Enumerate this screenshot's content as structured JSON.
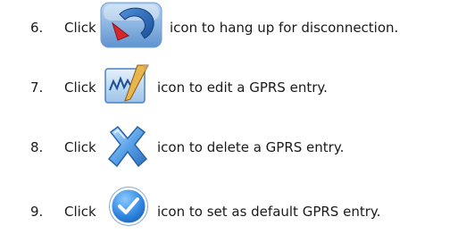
{
  "steps": [
    {
      "number": "6.",
      "click": "Click",
      "icon": "hang-up-icon",
      "text": "icon to hang up for disconnection."
    },
    {
      "number": "7.",
      "click": "Click",
      "icon": "edit-icon",
      "text": "icon to edit a GPRS entry."
    },
    {
      "number": "8.",
      "click": "Click",
      "icon": "delete-icon",
      "text": "icon to delete a GPRS entry."
    },
    {
      "number": "9.",
      "click": "Click",
      "icon": "checkmark-icon",
      "text": "icon to set as default GPRS entry."
    }
  ]
}
